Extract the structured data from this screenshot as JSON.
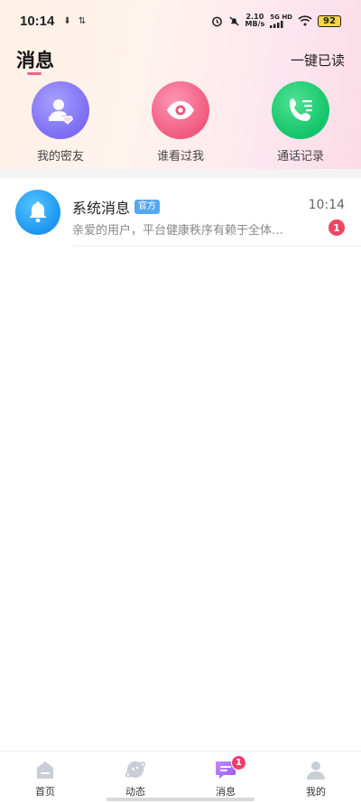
{
  "status_bar": {
    "time": "10:14",
    "download_glyph": "⬇",
    "data_glyph": "⇅",
    "net_speed_value": "2.10",
    "net_speed_unit": "MB/s",
    "signal_label": "5G HD",
    "battery": "92"
  },
  "header": {
    "title": "消息",
    "read_all": "一键已读"
  },
  "shortcuts": [
    {
      "label": "我的密友",
      "icon": "friend-heart-icon",
      "color": "#7d6cf3"
    },
    {
      "label": "谁看过我",
      "icon": "eye-icon",
      "color": "#f0597f"
    },
    {
      "label": "通话记录",
      "icon": "phone-log-icon",
      "color": "#12c46a"
    }
  ],
  "messages": [
    {
      "title": "系统消息",
      "badge": "官方",
      "time": "10:14",
      "preview": "亲爱的用户，平台健康秩序有赖于全体…",
      "unread": "1",
      "icon": "bell-icon"
    }
  ],
  "bottom_nav": [
    {
      "label": "首页",
      "icon": "home-icon",
      "active": false
    },
    {
      "label": "动态",
      "icon": "planet-icon",
      "active": false
    },
    {
      "label": "消息",
      "icon": "chat-icon",
      "active": true,
      "badge": "1"
    },
    {
      "label": "我的",
      "icon": "profile-icon",
      "active": false
    }
  ],
  "colors": {
    "accent_pink": "#ef6392",
    "badge_red": "#f0465e",
    "official_blue": "#55a7f5"
  }
}
